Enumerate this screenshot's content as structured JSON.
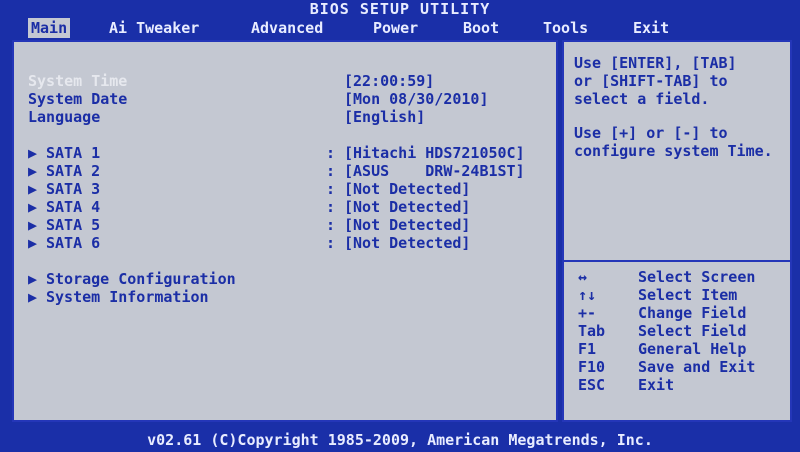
{
  "title": "BIOS SETUP UTILITY",
  "menu": [
    "Main",
    "Ai Tweaker",
    "Advanced",
    "Power",
    "Boot",
    "Tools",
    "Exit"
  ],
  "main": {
    "system_time": {
      "label": "System Time",
      "value": "[22:00:59]"
    },
    "system_date": {
      "label": "System Date",
      "value": "[Mon 08/30/2010]"
    },
    "language": {
      "label": "Language",
      "value": "[English]"
    },
    "sata": [
      {
        "label": "SATA 1",
        "value": "[Hitachi HDS721050C]"
      },
      {
        "label": "SATA 2",
        "value": "[ASUS    DRW-24B1ST]"
      },
      {
        "label": "SATA 3",
        "value": "[Not Detected]"
      },
      {
        "label": "SATA 4",
        "value": "[Not Detected]"
      },
      {
        "label": "SATA 5",
        "value": "[Not Detected]"
      },
      {
        "label": "SATA 6",
        "value": "[Not Detected]"
      }
    ],
    "submenus": [
      "Storage Configuration",
      "System Information"
    ],
    "arrow_glyph": "▶",
    "colon": ":"
  },
  "help": {
    "text1": "Use [ENTER], [TAB]\nor [SHIFT-TAB] to\nselect a field.",
    "text2": "Use [+] or [-] to\nconfigure system Time.",
    "keys": [
      {
        "key": "↔",
        "desc": "Select Screen"
      },
      {
        "key": "↑↓",
        "desc": "Select Item"
      },
      {
        "key": "+-",
        "desc": "Change Field"
      },
      {
        "key": "Tab",
        "desc": "Select Field"
      },
      {
        "key": "F1",
        "desc": "General Help"
      },
      {
        "key": "F10",
        "desc": "Save and Exit"
      },
      {
        "key": "ESC",
        "desc": "Exit"
      }
    ]
  },
  "footer": "v02.61 (C)Copyright 1985-2009, American Megatrends, Inc.",
  "colors": {
    "background": "#1a2fa8",
    "panel": "#c4c8d2",
    "text": "#1b2ea6",
    "highlight": "#e6e8ee"
  }
}
